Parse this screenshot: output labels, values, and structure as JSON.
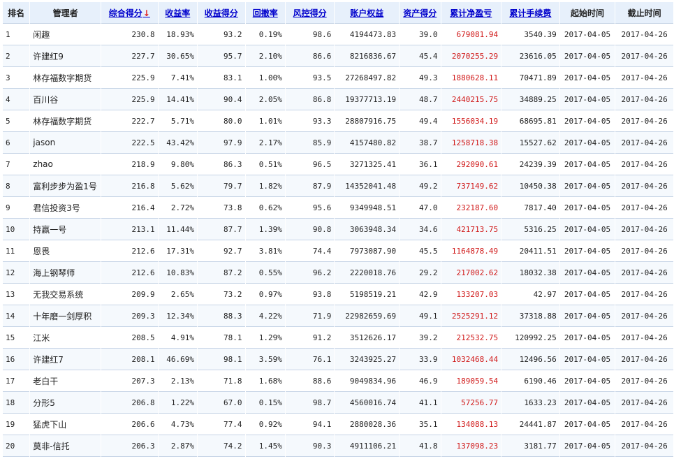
{
  "columns": [
    {
      "label": "排名",
      "sortable": false
    },
    {
      "label": "管理者",
      "sortable": false
    },
    {
      "label": "综合得分",
      "sortable": true,
      "sorted": true
    },
    {
      "label": "收益率",
      "sortable": true
    },
    {
      "label": "收益得分",
      "sortable": true
    },
    {
      "label": "回撤率",
      "sortable": true
    },
    {
      "label": "风控得分",
      "sortable": true
    },
    {
      "label": "账户权益",
      "sortable": true
    },
    {
      "label": "资产得分",
      "sortable": true
    },
    {
      "label": "累计净盈亏",
      "sortable": true
    },
    {
      "label": "累计手续费",
      "sortable": true
    },
    {
      "label": "起始时间",
      "sortable": false
    },
    {
      "label": "截止时间",
      "sortable": false
    }
  ],
  "sort_indicator": "↓",
  "accent_colors": {
    "link": "#0000cc",
    "profit": "#d01818",
    "header_bg": "#e7f0fb"
  },
  "rows": [
    [
      "1",
      "闲趣",
      "230.8",
      "18.93%",
      "93.2",
      "0.19%",
      "98.6",
      "4194473.83",
      "39.0",
      "679081.94",
      "3540.39",
      "2017-04-05",
      "2017-04-26"
    ],
    [
      "2",
      "许建红9",
      "227.7",
      "30.65%",
      "95.7",
      "2.10%",
      "86.6",
      "8216836.67",
      "45.4",
      "2070255.29",
      "23616.05",
      "2017-04-05",
      "2017-04-26"
    ],
    [
      "3",
      "林存福数字期货",
      "225.9",
      "7.41%",
      "83.1",
      "1.00%",
      "93.5",
      "27268497.82",
      "49.3",
      "1880628.11",
      "70471.89",
      "2017-04-05",
      "2017-04-26"
    ],
    [
      "4",
      "百川谷",
      "225.9",
      "14.41%",
      "90.4",
      "2.05%",
      "86.8",
      "19377713.19",
      "48.7",
      "2440215.75",
      "34889.25",
      "2017-04-05",
      "2017-04-26"
    ],
    [
      "5",
      "林存福数字期货",
      "222.7",
      "5.71%",
      "80.0",
      "1.01%",
      "93.3",
      "28807916.75",
      "49.4",
      "1556034.19",
      "68695.81",
      "2017-04-05",
      "2017-04-26"
    ],
    [
      "6",
      "jason",
      "222.5",
      "43.42%",
      "97.9",
      "2.17%",
      "85.9",
      "4157480.82",
      "38.7",
      "1258718.38",
      "15527.62",
      "2017-04-05",
      "2017-04-26"
    ],
    [
      "7",
      "zhao",
      "218.9",
      "9.80%",
      "86.3",
      "0.51%",
      "96.5",
      "3271325.41",
      "36.1",
      "292090.61",
      "24239.39",
      "2017-04-05",
      "2017-04-26"
    ],
    [
      "8",
      "富利步步为盈1号",
      "216.8",
      "5.62%",
      "79.7",
      "1.82%",
      "87.9",
      "14352041.48",
      "49.2",
      "737149.62",
      "10450.38",
      "2017-04-05",
      "2017-04-26"
    ],
    [
      "9",
      "君信投资3号",
      "216.4",
      "2.72%",
      "73.8",
      "0.62%",
      "95.6",
      "9349948.51",
      "47.0",
      "232187.60",
      "7817.40",
      "2017-04-05",
      "2017-04-26"
    ],
    [
      "10",
      "持赢一号",
      "213.1",
      "11.44%",
      "87.7",
      "1.39%",
      "90.8",
      "3063948.34",
      "34.6",
      "421713.75",
      "5316.25",
      "2017-04-05",
      "2017-04-26"
    ],
    [
      "11",
      "恩畏",
      "212.6",
      "17.31%",
      "92.7",
      "3.81%",
      "74.4",
      "7973087.90",
      "45.5",
      "1164878.49",
      "20411.51",
      "2017-04-05",
      "2017-04-26"
    ],
    [
      "12",
      "海上钢琴师",
      "212.6",
      "10.83%",
      "87.2",
      "0.55%",
      "96.2",
      "2220018.76",
      "29.2",
      "217002.62",
      "18032.38",
      "2017-04-05",
      "2017-04-26"
    ],
    [
      "13",
      "无我交易系统",
      "209.9",
      "2.65%",
      "73.2",
      "0.97%",
      "93.8",
      "5198519.21",
      "42.9",
      "133207.03",
      "42.97",
      "2017-04-05",
      "2017-04-26"
    ],
    [
      "14",
      "十年磨一剑厚积",
      "209.3",
      "12.34%",
      "88.3",
      "4.22%",
      "71.9",
      "22982659.69",
      "49.1",
      "2525291.12",
      "37318.88",
      "2017-04-05",
      "2017-04-26"
    ],
    [
      "15",
      "江米",
      "208.5",
      "4.91%",
      "78.1",
      "1.29%",
      "91.2",
      "3512626.17",
      "39.2",
      "212532.75",
      "120992.25",
      "2017-04-05",
      "2017-04-26"
    ],
    [
      "16",
      "许建红7",
      "208.1",
      "46.69%",
      "98.1",
      "3.59%",
      "76.1",
      "3243925.27",
      "33.9",
      "1032468.44",
      "12496.56",
      "2017-04-05",
      "2017-04-26"
    ],
    [
      "17",
      "老白干",
      "207.3",
      "2.13%",
      "71.8",
      "1.68%",
      "88.6",
      "9049834.96",
      "46.9",
      "189059.54",
      "6190.46",
      "2017-04-05",
      "2017-04-26"
    ],
    [
      "18",
      "分形5",
      "206.8",
      "1.22%",
      "67.0",
      "0.15%",
      "98.7",
      "4560016.74",
      "41.1",
      "57256.77",
      "1633.23",
      "2017-04-05",
      "2017-04-26"
    ],
    [
      "19",
      "猛虎下山",
      "206.6",
      "4.73%",
      "77.4",
      "0.92%",
      "94.1",
      "2880028.36",
      "35.1",
      "134088.13",
      "24441.87",
      "2017-04-05",
      "2017-04-26"
    ],
    [
      "20",
      "莫非-信托",
      "206.3",
      "2.87%",
      "74.2",
      "1.45%",
      "90.3",
      "4911106.21",
      "41.8",
      "137098.23",
      "3181.77",
      "2017-04-05",
      "2017-04-26"
    ]
  ]
}
